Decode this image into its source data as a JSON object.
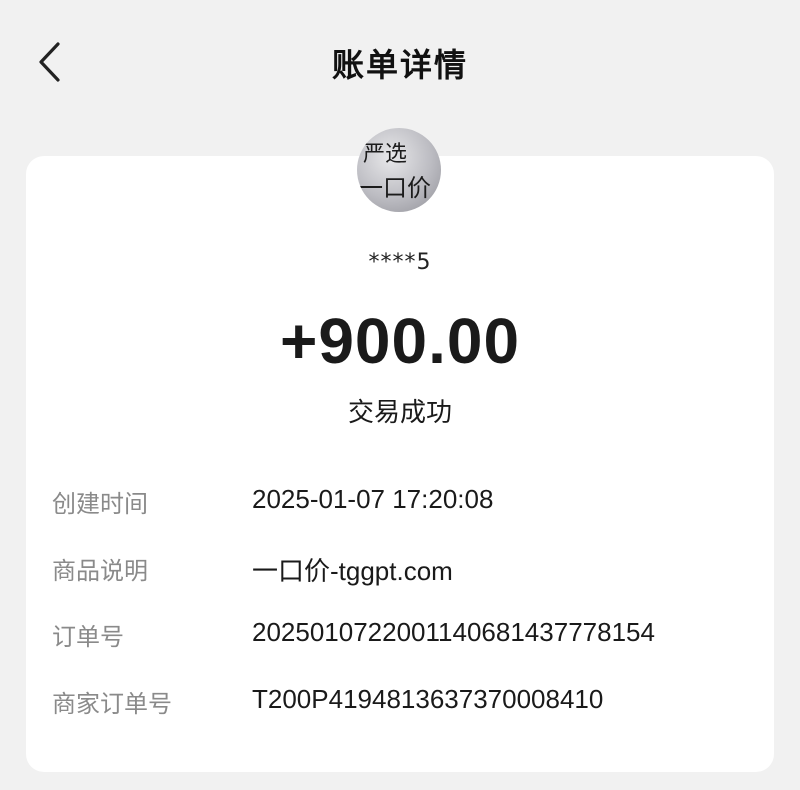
{
  "header": {
    "title": "账单详情",
    "back_icon": "chevron-left-icon"
  },
  "merchant": {
    "avatar_text_line1": "严选",
    "avatar_text_line2": "一口价",
    "account": "****5"
  },
  "transaction": {
    "amount": "+900.00",
    "status": "交易成功"
  },
  "details": [
    {
      "label": "创建时间",
      "value": "2025-01-07 17:20:08"
    },
    {
      "label": "商品说明",
      "value": "一口价-tggpt.com"
    },
    {
      "label": "订单号",
      "value": "2025010722001140681437778154"
    },
    {
      "label": "商家订单号",
      "value": "T200P4194813637370008410"
    }
  ],
  "colors": {
    "background": "#f1f1f1",
    "card": "#ffffff",
    "label_gray": "#8a8a8a",
    "text": "#1a1a1a"
  }
}
